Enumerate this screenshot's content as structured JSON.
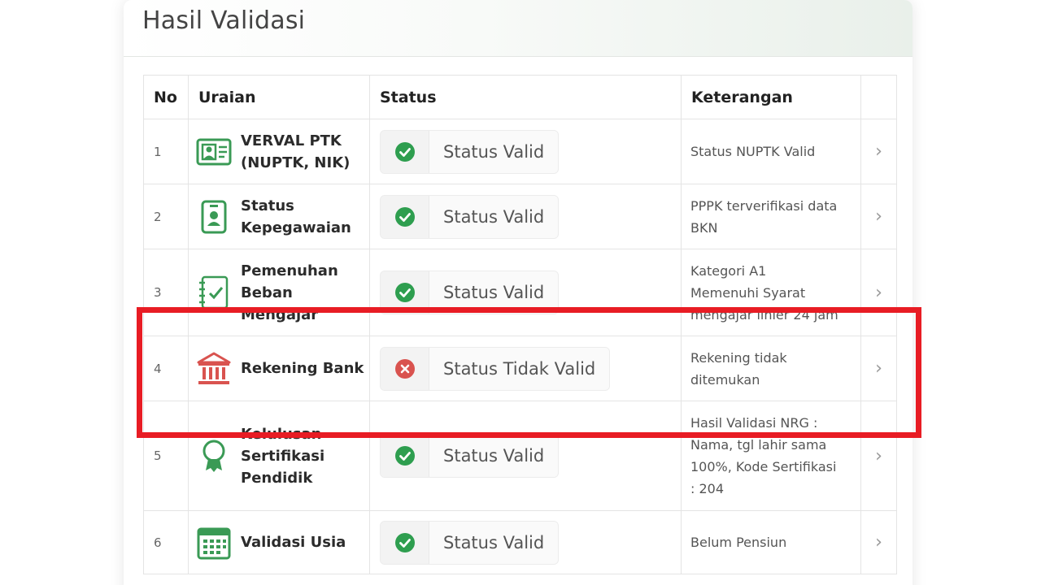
{
  "card": {
    "title": "Hasil Validasi"
  },
  "table": {
    "headers": {
      "no": "No",
      "uraian": "Uraian",
      "status": "Status",
      "keterangan": "Keterangan"
    },
    "rows": [
      {
        "no": "1",
        "uraian": [
          "VERVAL PTK",
          "(NUPTK, NIK)"
        ],
        "icon": "id-card-icon",
        "status": "Status Valid",
        "valid": true,
        "keterangan": [
          "Status NUPTK Valid"
        ]
      },
      {
        "no": "2",
        "uraian": [
          "Status",
          "Kepegawaian"
        ],
        "icon": "badge-icon",
        "status": "Status Valid",
        "valid": true,
        "keterangan": [
          "PPPK terverifikasi data",
          "BKN"
        ]
      },
      {
        "no": "3",
        "uraian": [
          "Pemenuhan",
          "Beban",
          "Mengajar"
        ],
        "icon": "checklist-icon",
        "status": "Status Valid",
        "valid": true,
        "keterangan": [
          "Kategori A1",
          "Memenuhi Syarat",
          "mengajar linier 24 jam"
        ]
      },
      {
        "no": "4",
        "uraian": [
          "Rekening Bank"
        ],
        "icon": "bank-icon",
        "status": "Status Tidak Valid",
        "valid": false,
        "keterangan": [
          "Rekening tidak",
          "ditemukan"
        ]
      },
      {
        "no": "5",
        "uraian": [
          "Kelulusan",
          "Sertifikasi",
          "Pendidik"
        ],
        "icon": "certificate-icon",
        "status": "Status Valid",
        "valid": true,
        "keterangan": [
          "Hasil Validasi NRG :",
          "Nama, tgl lahir sama",
          "100%, Kode Sertifikasi",
          ": 204"
        ]
      },
      {
        "no": "6",
        "uraian": [
          "Validasi Usia"
        ],
        "icon": "calendar-icon",
        "status": "Status Valid",
        "valid": true,
        "keterangan": [
          "Belum Pensiun"
        ]
      }
    ]
  },
  "colors": {
    "valid": "#2e9e4f",
    "invalid": "#d9534f",
    "highlight": "#e81c24",
    "icon_green": "#3a9a55",
    "icon_red": "#d9534f"
  }
}
